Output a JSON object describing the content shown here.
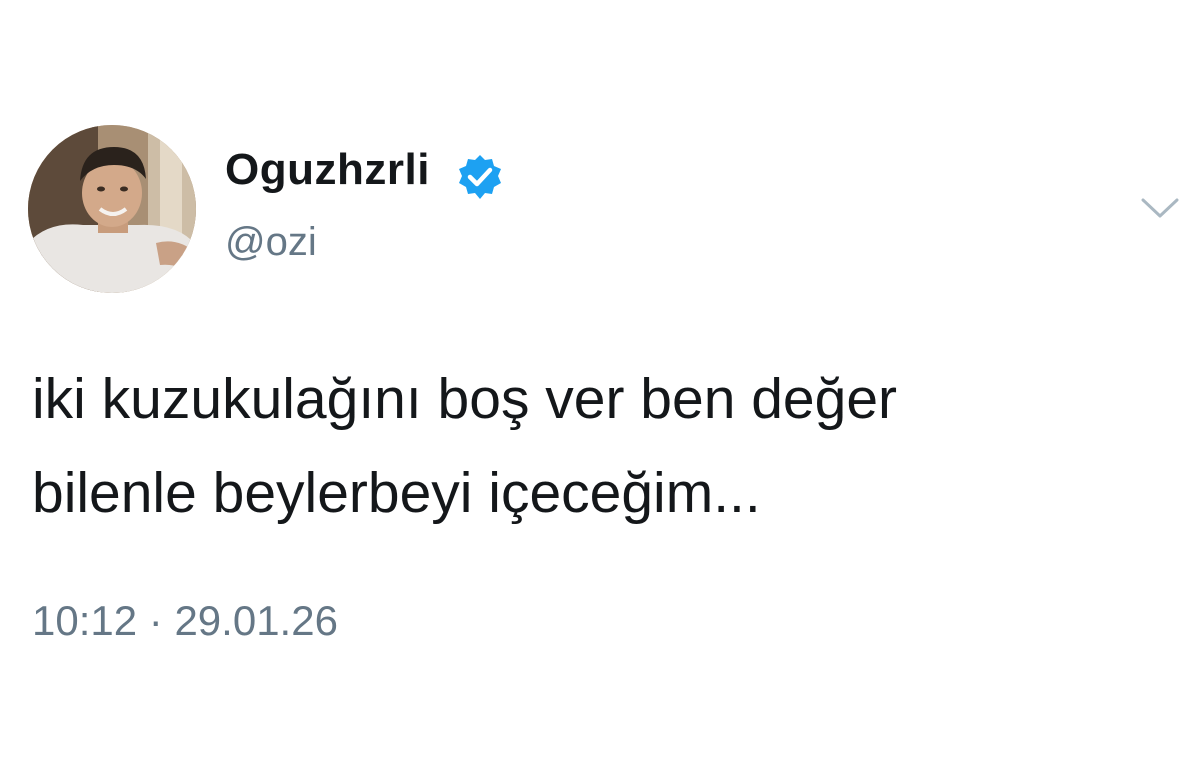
{
  "author": {
    "display_name": "Oguzhzrli",
    "handle": "@ozi",
    "verified": true,
    "avatar_icon": "profile-photo"
  },
  "tweet": {
    "text": "iki kuzukulağını boş ver ben değer\nbilenle beylerbeyi içeceğim...",
    "time": "10:12",
    "separator": "·",
    "date": "29.01.26"
  },
  "icons": {
    "verified": "verified-check-icon",
    "menu": "chevron-down-icon"
  },
  "colors": {
    "verified_blue": "#1da1f2",
    "secondary_text": "#657786",
    "primary_text": "#14171a"
  }
}
